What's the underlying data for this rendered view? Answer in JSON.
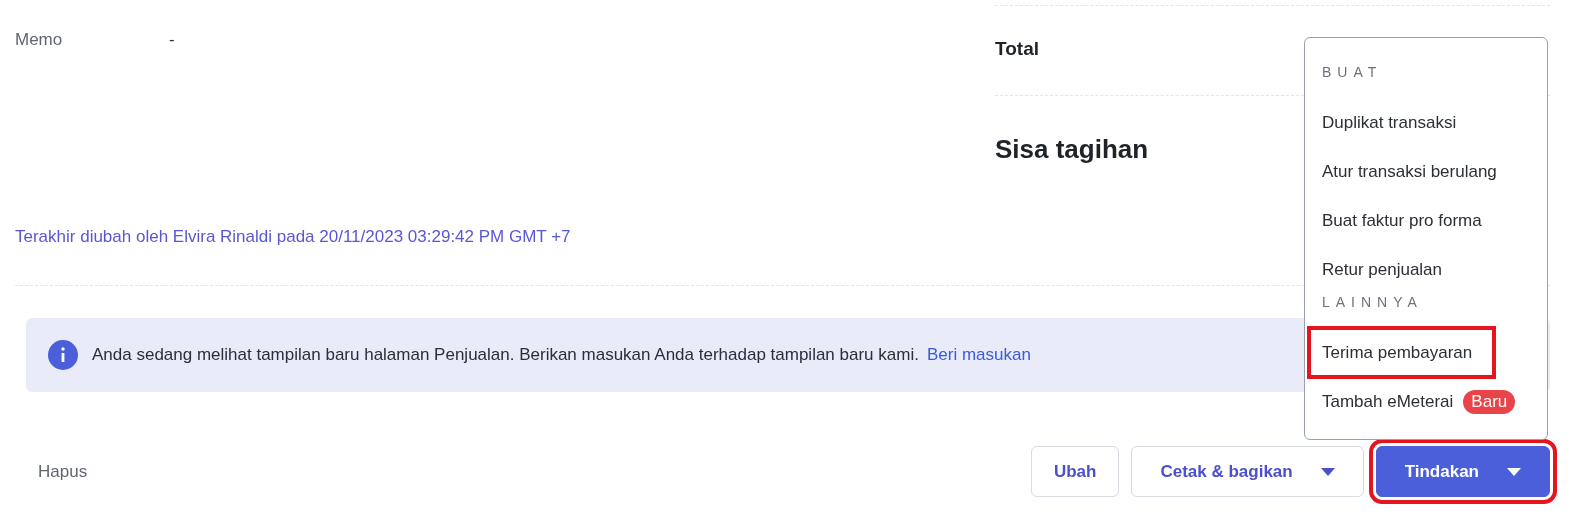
{
  "memo": {
    "label": "Memo",
    "value": "-"
  },
  "summary": [
    {
      "label": "Total",
      "kind": "total"
    },
    {
      "label": "Sisa tagihan",
      "kind": "balance"
    }
  ],
  "last_edited": "Terakhir diubah oleh Elvira Rinaldi pada 20/11/2023 03:29:42 PM GMT +7",
  "banner": {
    "text": "Anda sedang melihat tampilan baru halaman Penjualan. Berikan masukan Anda terhadap tampilan baru kami.",
    "link": "Beri masukan"
  },
  "footer": {
    "delete": "Hapus",
    "buttons": [
      {
        "label": "Ubah",
        "kind": "plain",
        "highlighted": false
      },
      {
        "label": "Cetak & bagikan",
        "kind": "dropdown",
        "highlighted": false
      },
      {
        "label": "Tindakan",
        "kind": "primary",
        "highlighted": true
      }
    ]
  },
  "menu": {
    "sections": [
      {
        "title": "BUAT",
        "items": [
          {
            "label": "Duplikat transaksi",
            "highlighted": false
          },
          {
            "label": "Atur transaksi berulang",
            "highlighted": false
          },
          {
            "label": "Buat faktur pro forma",
            "highlighted": false
          },
          {
            "label": "Retur penjualan",
            "highlighted": false
          }
        ]
      },
      {
        "title": "LAINNYA",
        "items": [
          {
            "label": "Terima pembayaran",
            "highlighted": true
          },
          {
            "label": "Tambah eMeterai",
            "highlighted": false,
            "badge": "Baru"
          }
        ]
      }
    ]
  }
}
